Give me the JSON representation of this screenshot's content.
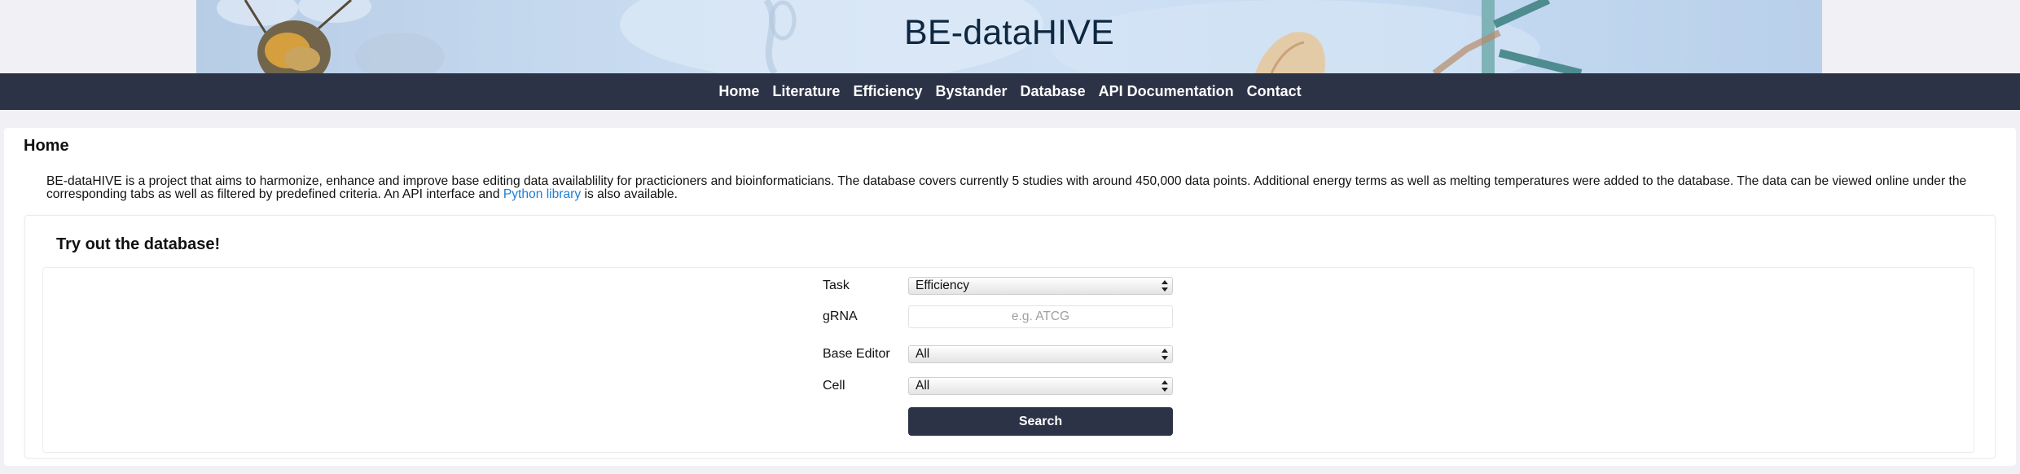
{
  "header": {
    "title": "BE-dataHIVE"
  },
  "nav": {
    "items": [
      "Home",
      "Literature",
      "Efficiency",
      "Bystander",
      "Database",
      "API Documentation",
      "Contact"
    ]
  },
  "main": {
    "page_title": "Home",
    "intro": {
      "text_before_link": "BE-dataHIVE is a project that aims to harmonize, enhance and improve base editing data availablility for practicioners and bioinformaticians. The database covers currently 5 studies with around 450,000 data points. Additional energy terms as well as melting temperatures were added to the database. The data can be viewed online under the corresponding tabs as well as filtered by predefined criteria. An API interface and ",
      "link_text": "Python library",
      "text_after_link": " is also available."
    }
  },
  "search_form": {
    "title": "Try out the database!",
    "task": {
      "label": "Task",
      "value": "Efficiency"
    },
    "grna": {
      "label": "gRNA",
      "placeholder": "e.g. ATCG"
    },
    "base_editor": {
      "label": "Base Editor",
      "value": "All"
    },
    "cell": {
      "label": "Cell",
      "value": "All"
    },
    "search_label": "Search"
  },
  "colors": {
    "navbar": "#2d3347",
    "title": "#0e2740",
    "link": "#1a7fd6",
    "search_button": "#2d3347"
  }
}
